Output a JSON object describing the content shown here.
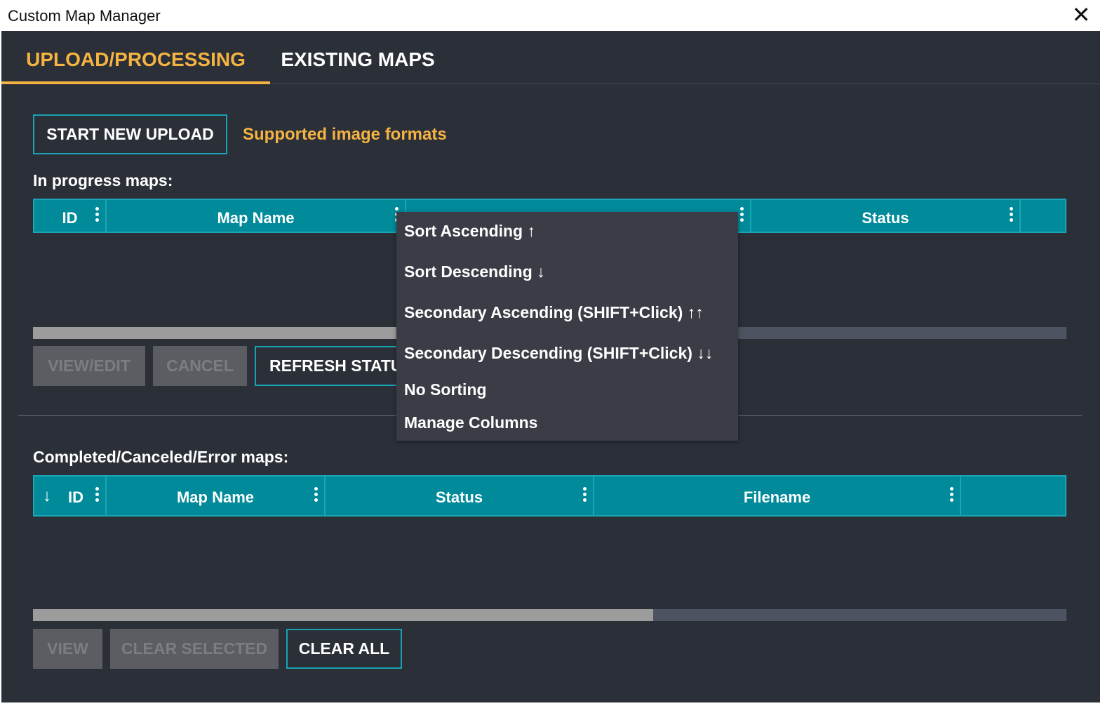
{
  "window": {
    "title": "Custom Map Manager",
    "close_glyph": "✕"
  },
  "tabs": [
    {
      "label": "UPLOAD/PROCESSING",
      "active": true
    },
    {
      "label": "EXISTING MAPS",
      "active": false
    }
  ],
  "upload": {
    "start_button": "START NEW UPLOAD",
    "formats_link": "Supported image formats"
  },
  "in_progress": {
    "label": "In progress maps:",
    "columns": [
      "ID",
      "Map Name",
      "Status"
    ],
    "scroll_thumb_fraction": 0.36,
    "buttons": {
      "view_edit": "VIEW/EDIT",
      "cancel": "CANCEL",
      "refresh": "REFRESH STATUS"
    }
  },
  "completed": {
    "label": "Completed/Canceled/Error maps:",
    "sort_indicator": "↓",
    "columns": [
      "ID",
      "Map Name",
      "Status",
      "Filename"
    ],
    "scroll_thumb_fraction": 0.6,
    "buttons": {
      "view": "VIEW",
      "clear_selected": "CLEAR SELECTED",
      "clear_all": "CLEAR ALL"
    }
  },
  "column_menu": {
    "items": [
      "Sort Ascending ↑",
      "Sort Descending ↓",
      "Secondary Ascending (SHIFT+Click) ↑↑",
      "Secondary Descending (SHIFT+Click) ↓↓",
      "No Sorting",
      "Manage Columns"
    ]
  },
  "colors": {
    "background": "#2b2f38",
    "accent": "#f5b342",
    "header": "#008a9a",
    "outline": "#17a3b3",
    "menu": "#3a3d46"
  }
}
